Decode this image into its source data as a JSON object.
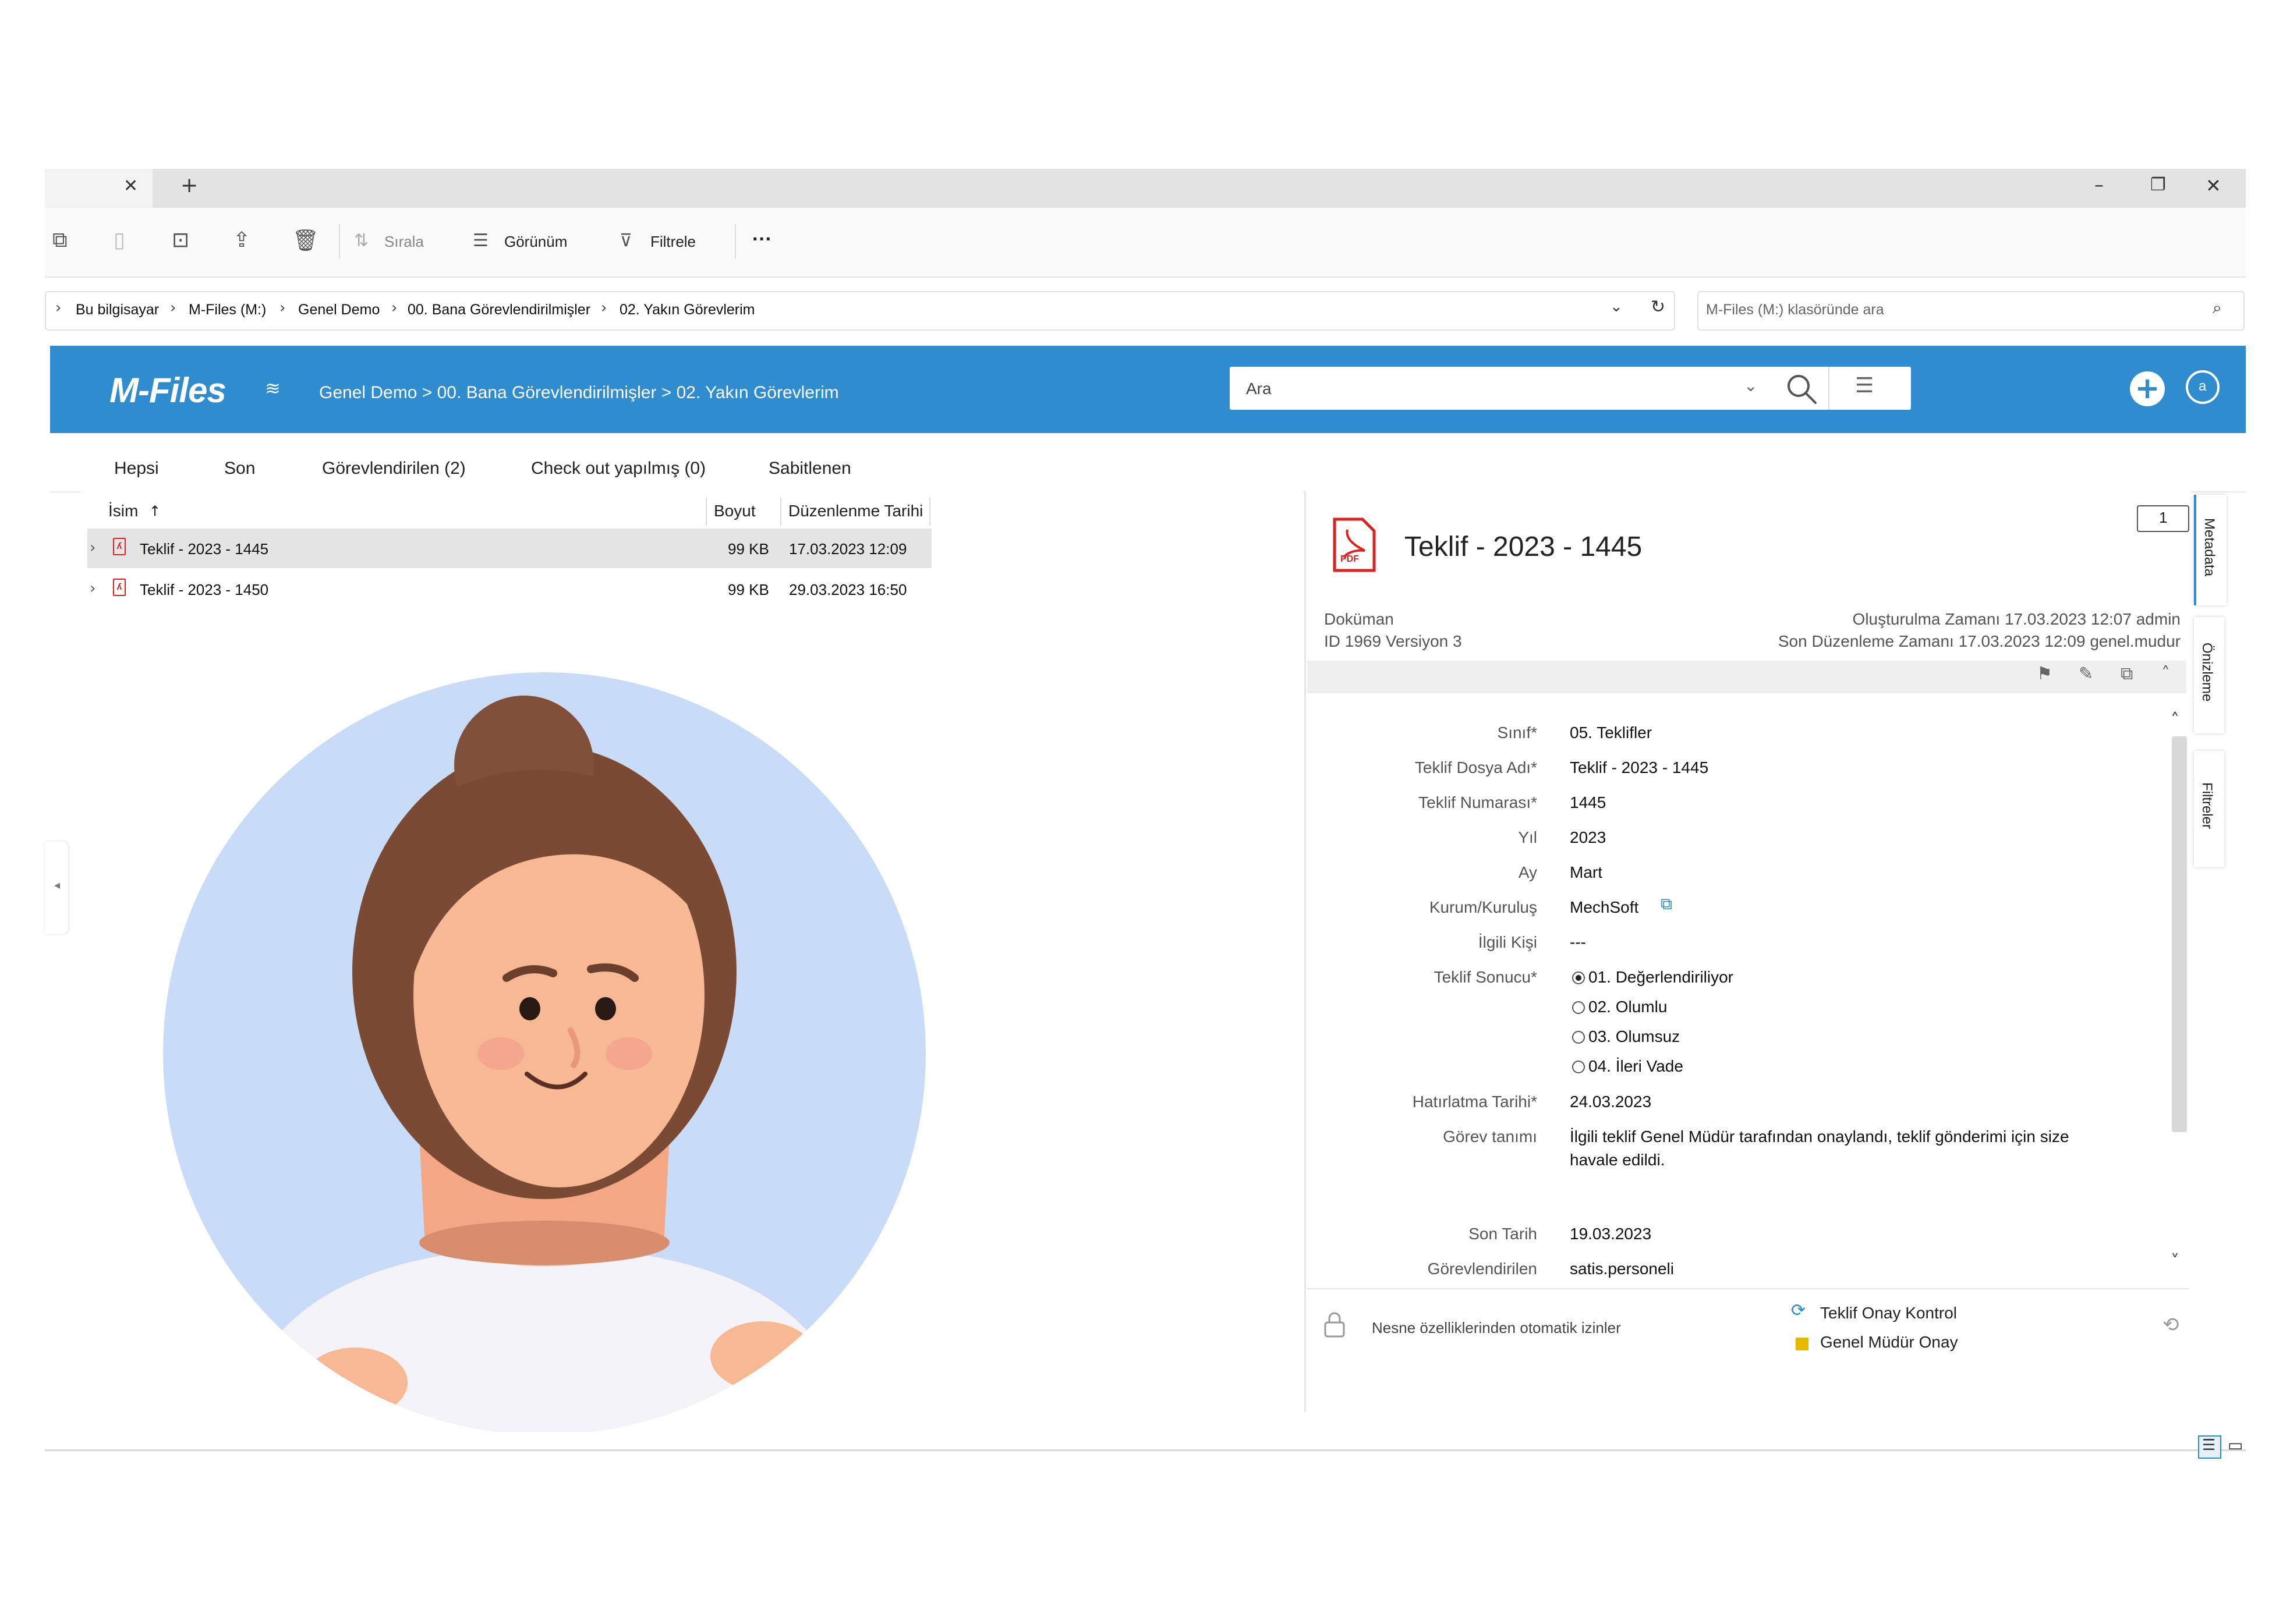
{
  "window": {
    "tab_close": "✕",
    "new_tab": "+",
    "minimize": "–",
    "restore": "❐",
    "close": "✕"
  },
  "toolbar": {
    "sort_label": "Sırala",
    "view_label": "Görünüm",
    "filter_label": "Filtrele",
    "more_label": "···"
  },
  "address": {
    "crumbs": [
      "Bu bilgisayar",
      "M-Files (M:)",
      "Genel Demo",
      "00. Bana Görevlendirilmişler",
      "02. Yakın Görevlerim"
    ],
    "search_placeholder": "M-Files (M:) klasöründe ara"
  },
  "mfiles": {
    "logo": "M-Files",
    "path": "Genel Demo > 00. Bana Görevlendirilmişler > 02. Yakın Görevlerim",
    "search_placeholder": "Ara",
    "user_initial": "a",
    "brand_color": "#2f8ccf"
  },
  "view_tabs": [
    "Hepsi",
    "Son",
    "Görevlendirilen (2)",
    "Check out yapılmış (0)",
    "Sabitlenen"
  ],
  "list": {
    "columns": {
      "name": "İsim",
      "size": "Boyut",
      "modified": "Düzenlenme Tarihi"
    },
    "sort_indicator": "↑",
    "rows": [
      {
        "name": "Teklif - 2023 - 1445",
        "size": "99 KB",
        "modified": "17.03.2023 12:09",
        "selected": true
      },
      {
        "name": "Teklif - 2023 - 1450",
        "size": "99 KB",
        "modified": "29.03.2023 16:50",
        "selected": false
      }
    ]
  },
  "metadata": {
    "title": "Teklif - 2023 - 1445",
    "comment_count": "1",
    "object_type": "Doküman",
    "id_version": "ID 1969  Versiyon 3",
    "created": "Oluşturulma Zamanı 17.03.2023 12:07 admin",
    "modified": "Son Düzenleme Zamanı 17.03.2023 12:09 genel.mudur",
    "pdf_label": "PDF",
    "fields": {
      "sinif_label": "Sınıf*",
      "sinif_value": "05. Teklifler",
      "dosya_label": "Teklif Dosya Adı*",
      "dosya_value": "Teklif - 2023 - 1445",
      "numara_label": "Teklif Numarası*",
      "numara_value": "1445",
      "yil_label": "Yıl",
      "yil_value": "2023",
      "ay_label": "Ay",
      "ay_value": "Mart",
      "kurum_label": "Kurum/Kuruluş",
      "kurum_value": "MechSoft",
      "kisi_label": "İlgili Kişi",
      "kisi_value": "---",
      "sonuc_label": "Teklif Sonucu*",
      "sonuc_options": [
        "01. Değerlendiriliyor",
        "02. Olumlu",
        "03. Olumsuz",
        "04. İleri Vade"
      ],
      "hatirlatma_label": "Hatırlatma Tarihi*",
      "hatirlatma_value": "24.03.2023",
      "gorev_label": "Görev tanımı",
      "gorev_value_line1": "İlgili teklif Genel Müdür tarafından onaylandı, teklif gönderimi için size",
      "gorev_value_line2": "havale edildi.",
      "son_tarih_label": "Son Tarih",
      "son_tarih_value": "19.03.2023",
      "gorevlendirilen_label": "Görevlendirilen",
      "gorevlendirilen_value": "satis.personeli"
    },
    "footer": {
      "permissions": "Nesne özelliklerinden otomatik izinler",
      "workflow": "Teklif Onay Kontrol",
      "state": "Genel Müdür Onay",
      "state_color": "#e8b800"
    }
  },
  "side_tabs": [
    "Metadata",
    "Önizleme",
    "Filtreler"
  ]
}
